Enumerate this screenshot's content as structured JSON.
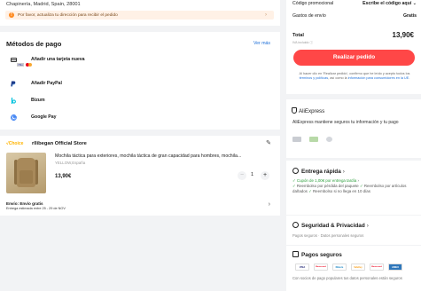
{
  "address": {
    "line": "Chapinería, Madrid, Spain, 28001",
    "warning": "Por favor, actualiza tu dirección para recibir el pedido"
  },
  "payment": {
    "title": "Métodos de pago",
    "see_more": "Ver más",
    "methods": [
      {
        "label": "Añadir una tarjeta nueva",
        "icon": "credit-card-icon"
      },
      {
        "label": "Añadir PayPal",
        "icon": "paypal-icon"
      },
      {
        "label": "Bizum",
        "icon": "bizum-icon"
      },
      {
        "label": "Google Pay",
        "icon": "google-pay-icon"
      }
    ],
    "card_brand_visa": "VISA"
  },
  "store": {
    "badge_prefix": "√",
    "badge": "Choice",
    "name": "rllibegan Official Store",
    "product_title": "Mochila táctica para exteriores, mochila táctica de gran capacidad para hombres, mochila...",
    "variant": "YELLOW,España",
    "price": "13,90€",
    "quantity": "1",
    "shipping_title": "Envío: Envío gratis",
    "shipping_sub": "Entrega estimada entre 25 - 29 de NOV"
  },
  "summary": {
    "promo_label": "Código promocional",
    "promo_action": "Escribe el código aquí",
    "shipping_label": "Gastos de envío",
    "shipping_value": "Gratis",
    "total_label": "Total",
    "total_value": "13,90€",
    "iva": "IVA incluido ⓘ",
    "cta": "Realizar pedido",
    "legal_a": "Al hacer clic en 'Realizar pedido', confirmo que he leído y acepto todos los ",
    "legal_link1": "términos y políticas",
    "legal_b": ", así como la ",
    "legal_link2": "información para consumidores en la UE",
    "legal_c": "."
  },
  "aliexpress": {
    "logo": "AliExpress",
    "text": "AliExpress mantiene seguros tu información y tu pago"
  },
  "fast": {
    "title": "Entrega rápida",
    "line1": "✓ Cupón de 1,00€ por entrega tardía",
    "line2": "Reembolso por pérdida del paquete",
    "line3": "Reembolso por artículos dañados",
    "line4": "Reembolso si no llega en 10 días"
  },
  "security": {
    "title": "Seguridad & Privacidad",
    "sub": "Pagos seguros · Datos personales seguros"
  },
  "safe_pay": {
    "title": "Pagos seguros",
    "logos": [
      "VISA",
      "Mastercard",
      "Diners",
      "SafeKey",
      "Mastercard",
      "AMEX"
    ],
    "text": "Con socios de pago populares tus datos personales están seguros"
  }
}
